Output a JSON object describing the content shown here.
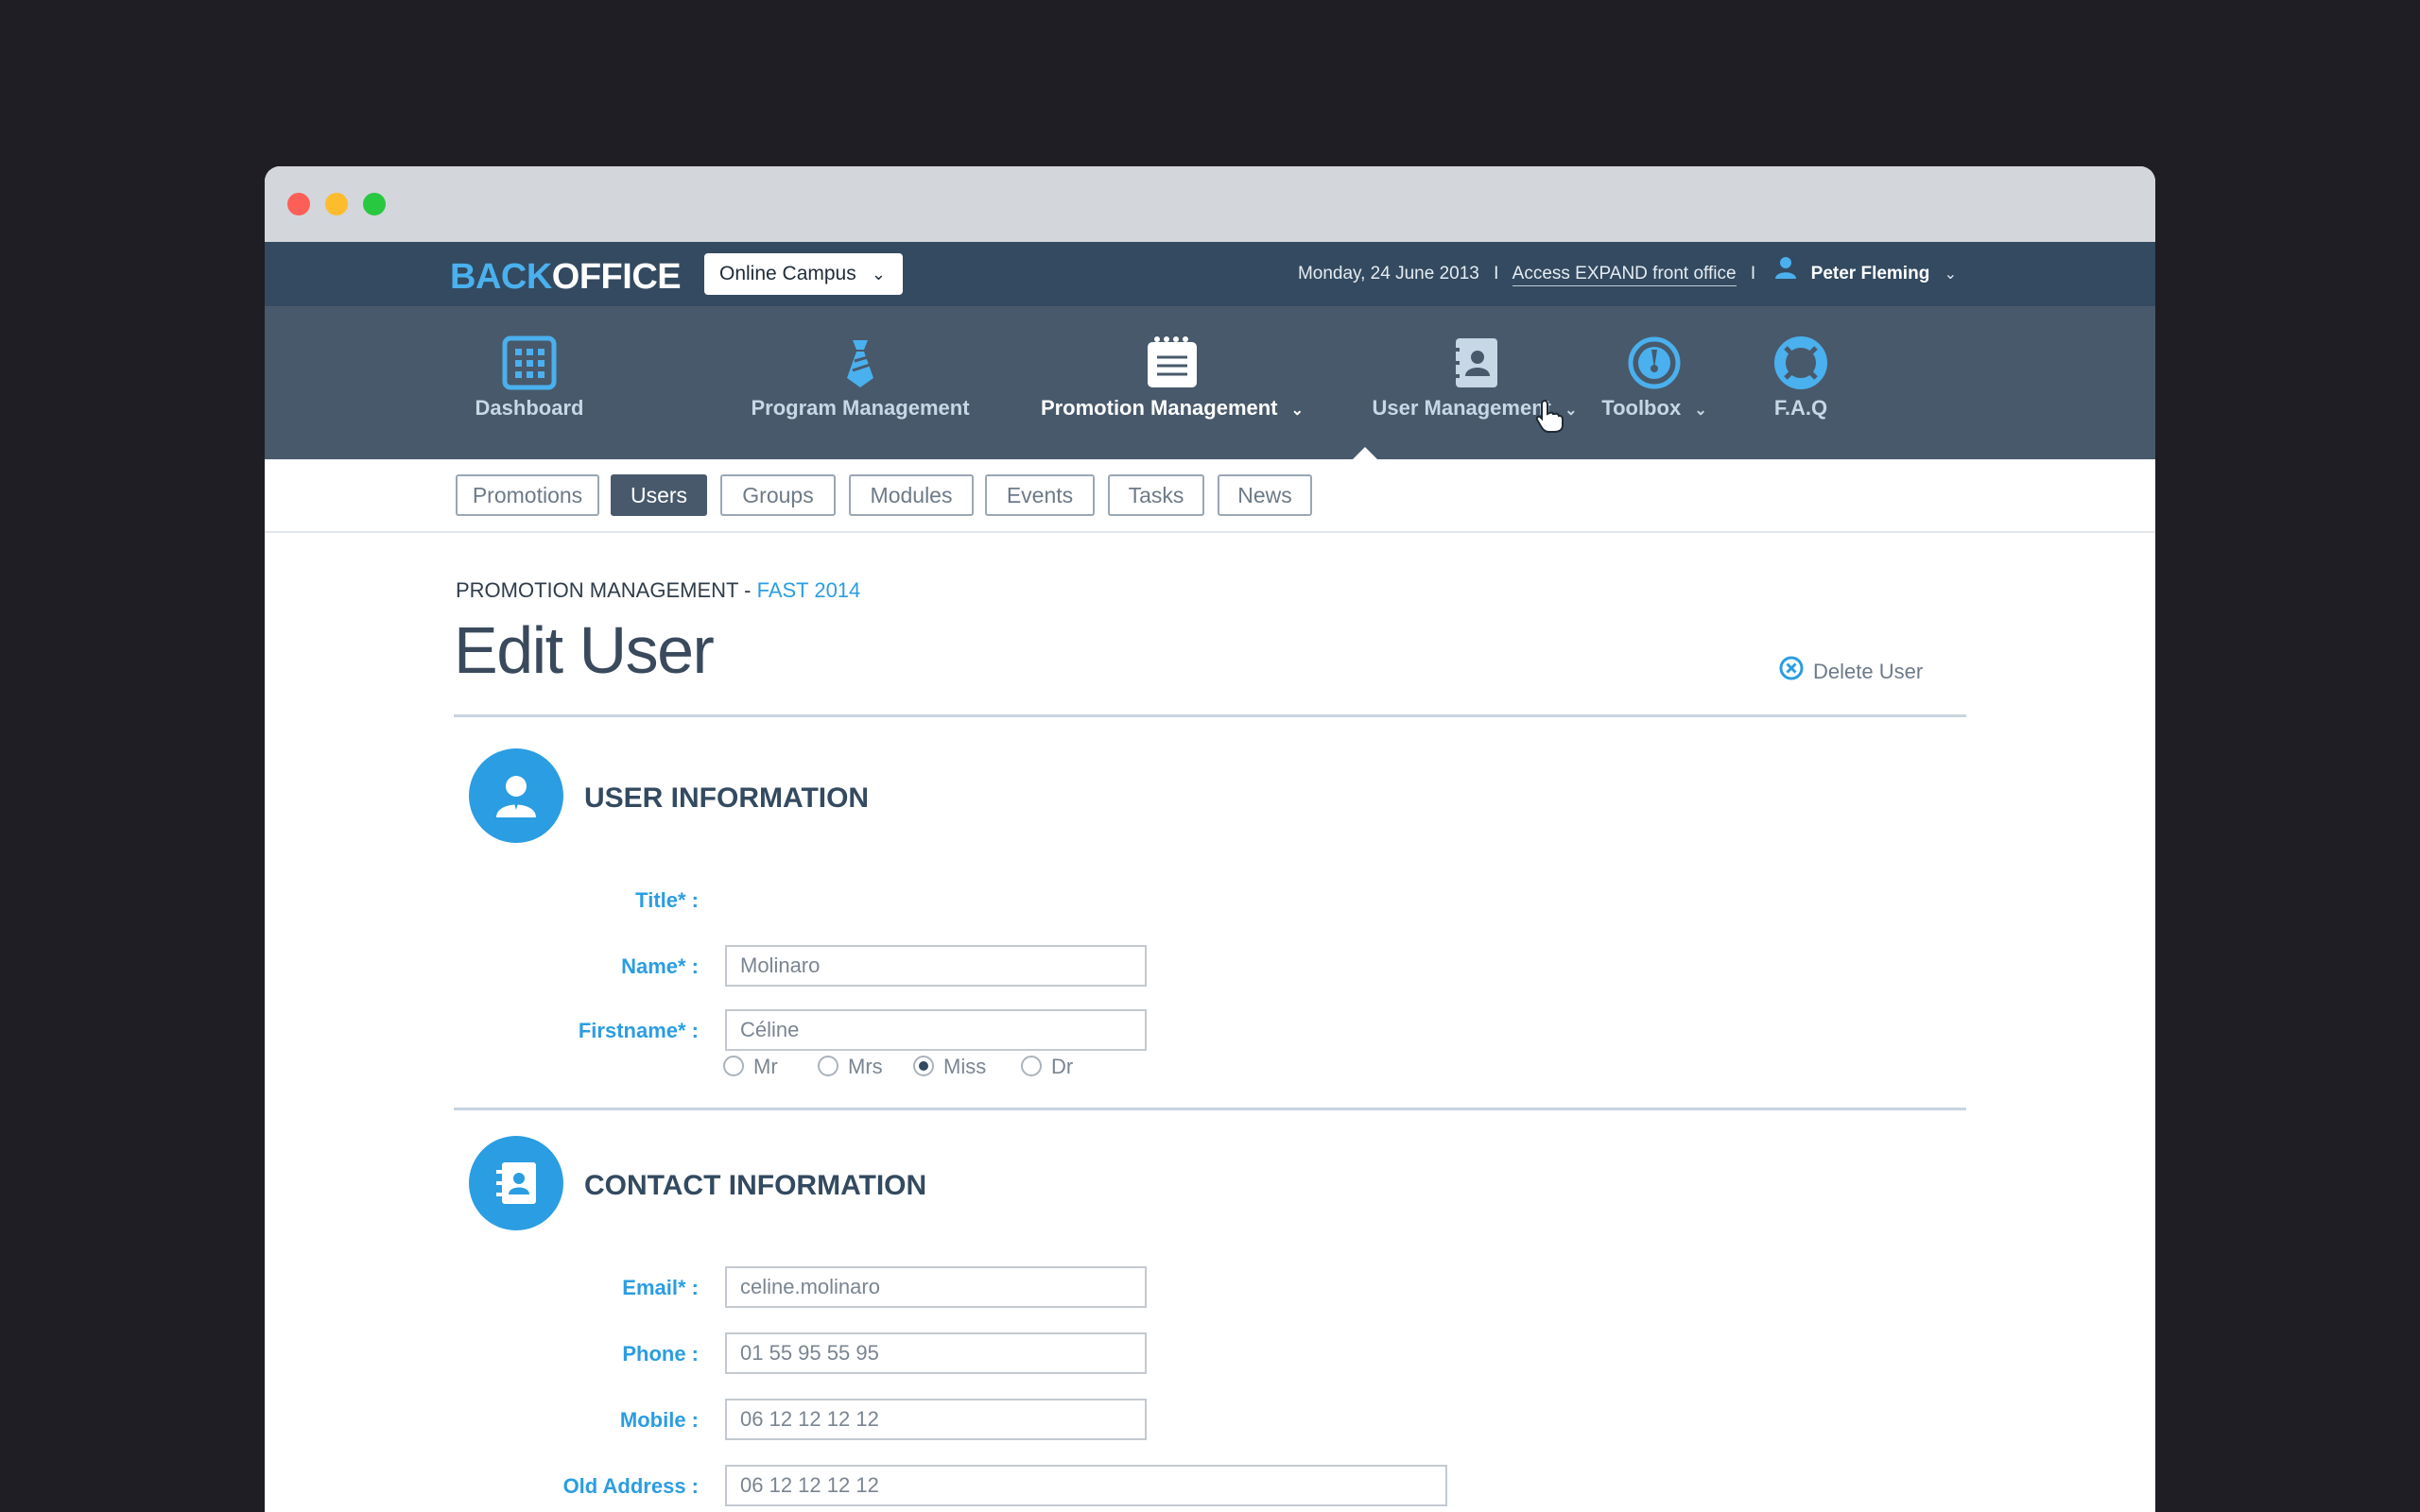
{
  "topbar": {
    "logo_back": "BACK",
    "logo_office": "OFFICE",
    "campus_select": "Online Campus",
    "date": "Monday, 24 June 2013",
    "separator": "I",
    "front_office_link": "Access EXPAND front office",
    "user_name": "Peter Fleming"
  },
  "nav": {
    "items": [
      {
        "label": "Dashboard",
        "icon": "grid-calendar-icon"
      },
      {
        "label": "Program Management",
        "icon": "tie-icon"
      },
      {
        "label": "Promotion Management",
        "icon": "notepad-icon",
        "active": true
      },
      {
        "label": "User Management",
        "icon": "contact-book-icon"
      },
      {
        "label": "Toolbox",
        "icon": "gauge-icon"
      },
      {
        "label": "F.A.Q",
        "icon": "lifebuoy-icon"
      }
    ]
  },
  "subnav": {
    "tabs": [
      "Promotions",
      "Users",
      "Groups",
      "Modules",
      "Events",
      "Tasks",
      "News"
    ],
    "active": "Users"
  },
  "page": {
    "breadcrumb_main": "PROMOTION MANAGEMENT - ",
    "breadcrumb_highlight": "FAST 2014",
    "title": "Edit User",
    "delete_label": "Delete User"
  },
  "user_info": {
    "heading": "USER INFORMATION",
    "title_label": "Title* :",
    "title_options": [
      "Mr",
      "Mrs",
      "Miss",
      "Dr"
    ],
    "title_selected": "Miss",
    "name_label": "Name* :",
    "name_value": "Molinaro",
    "firstname_label": "Firstname* :",
    "firstname_value": "Céline"
  },
  "contact_info": {
    "heading": "CONTACT INFORMATION",
    "email_label": "Email* :",
    "email_value": "celine.molinaro",
    "phone_label": "Phone :",
    "phone_value": "01 55 95 55 95",
    "mobile_label": "Mobile :",
    "mobile_value": "06 12 12 12 12",
    "old_address_label": "Old Address :",
    "old_address_value": "06 12 12 12 12"
  },
  "colors": {
    "accent": "#2b9de2",
    "topbar": "#334a60",
    "nav": "#48596b",
    "label": "#2b9de2"
  }
}
